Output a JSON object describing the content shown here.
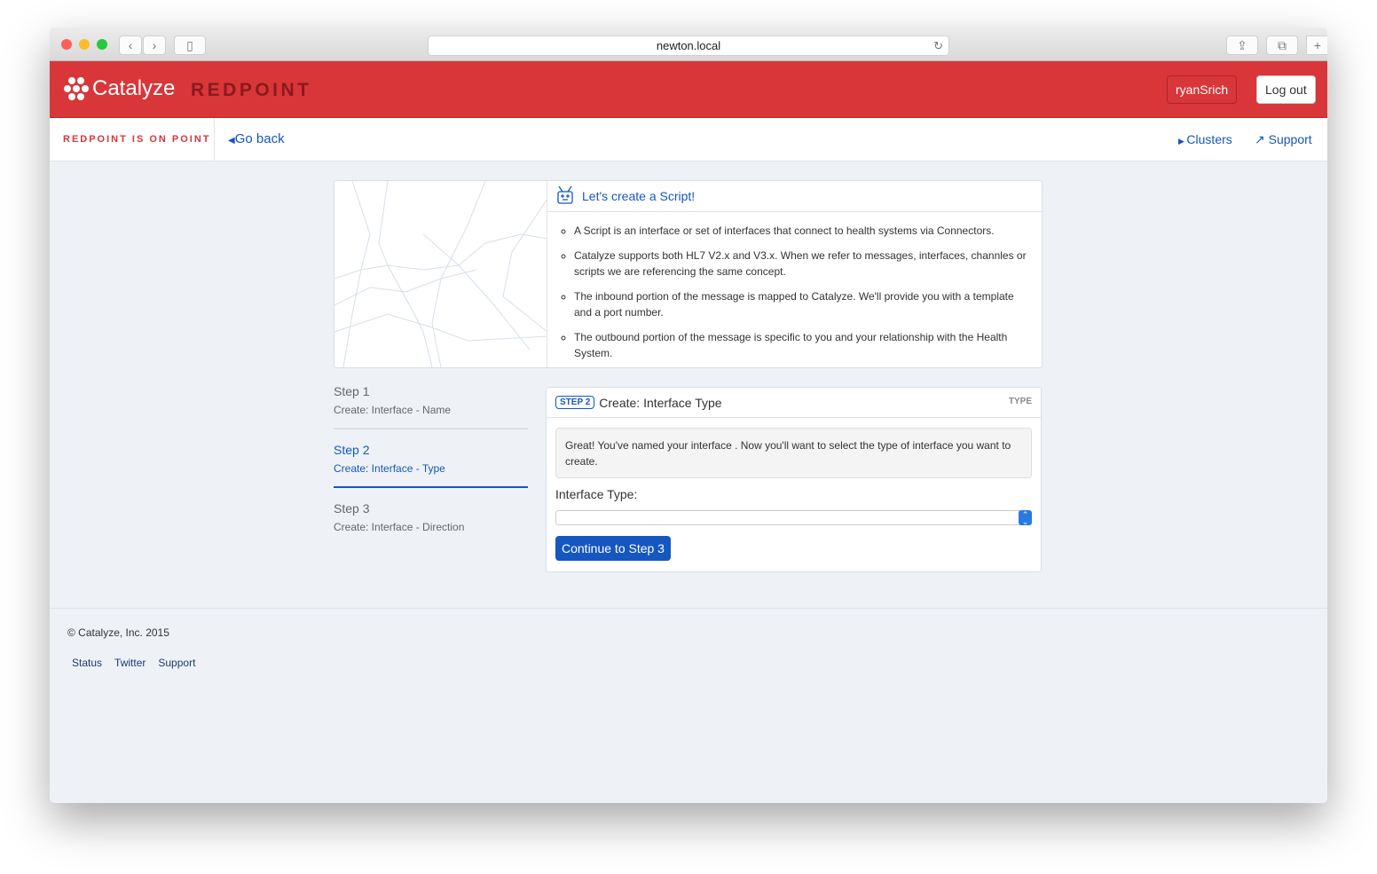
{
  "browser": {
    "url": "newton.local"
  },
  "header": {
    "brand": "Catalyze",
    "product": "REDPOINT",
    "user": "ryanSrich",
    "logout": "Log out"
  },
  "subnav": {
    "tagline": "REDPOINT IS ON POINT",
    "go_back": "Go back",
    "clusters": "Clusters",
    "support": "Support"
  },
  "intro": {
    "title": "Let's create a Script!",
    "bullets": [
      "A Script is an interface or set of interfaces that connect to health systems via Connectors.",
      "Catalyze supports both HL7 V2.x and V3.x. When we refer to messages, interfaces, channles or scripts we are referencing the same concept.",
      "The inbound portion of the message is mapped to Catalyze. We'll provide you with a template and a port number.",
      "The outbound portion of the message is specific to you and your relationship with the Health System."
    ]
  },
  "steps": [
    {
      "title": "Step 1",
      "subtitle": "Create: Interface - Name"
    },
    {
      "title": "Step 2",
      "subtitle": "Create: Interface - Type",
      "active": true
    },
    {
      "title": "Step 3",
      "subtitle": "Create: Interface - Direction"
    }
  ],
  "card": {
    "badge": "STEP 2",
    "title": "Create: Interface Type",
    "tag": "TYPE",
    "message": "Great! You've named your interface . Now you'll want to select the type of interface you want to create.",
    "field_label": "Interface Type:",
    "field_value": "",
    "button": "Continue to Step 3"
  },
  "footer": {
    "copyright": "© Catalyze, Inc. 2015",
    "links": [
      "Status",
      "Twitter",
      "Support"
    ]
  },
  "colors": {
    "brand_red": "#d9363a",
    "link_blue": "#1557c0"
  }
}
